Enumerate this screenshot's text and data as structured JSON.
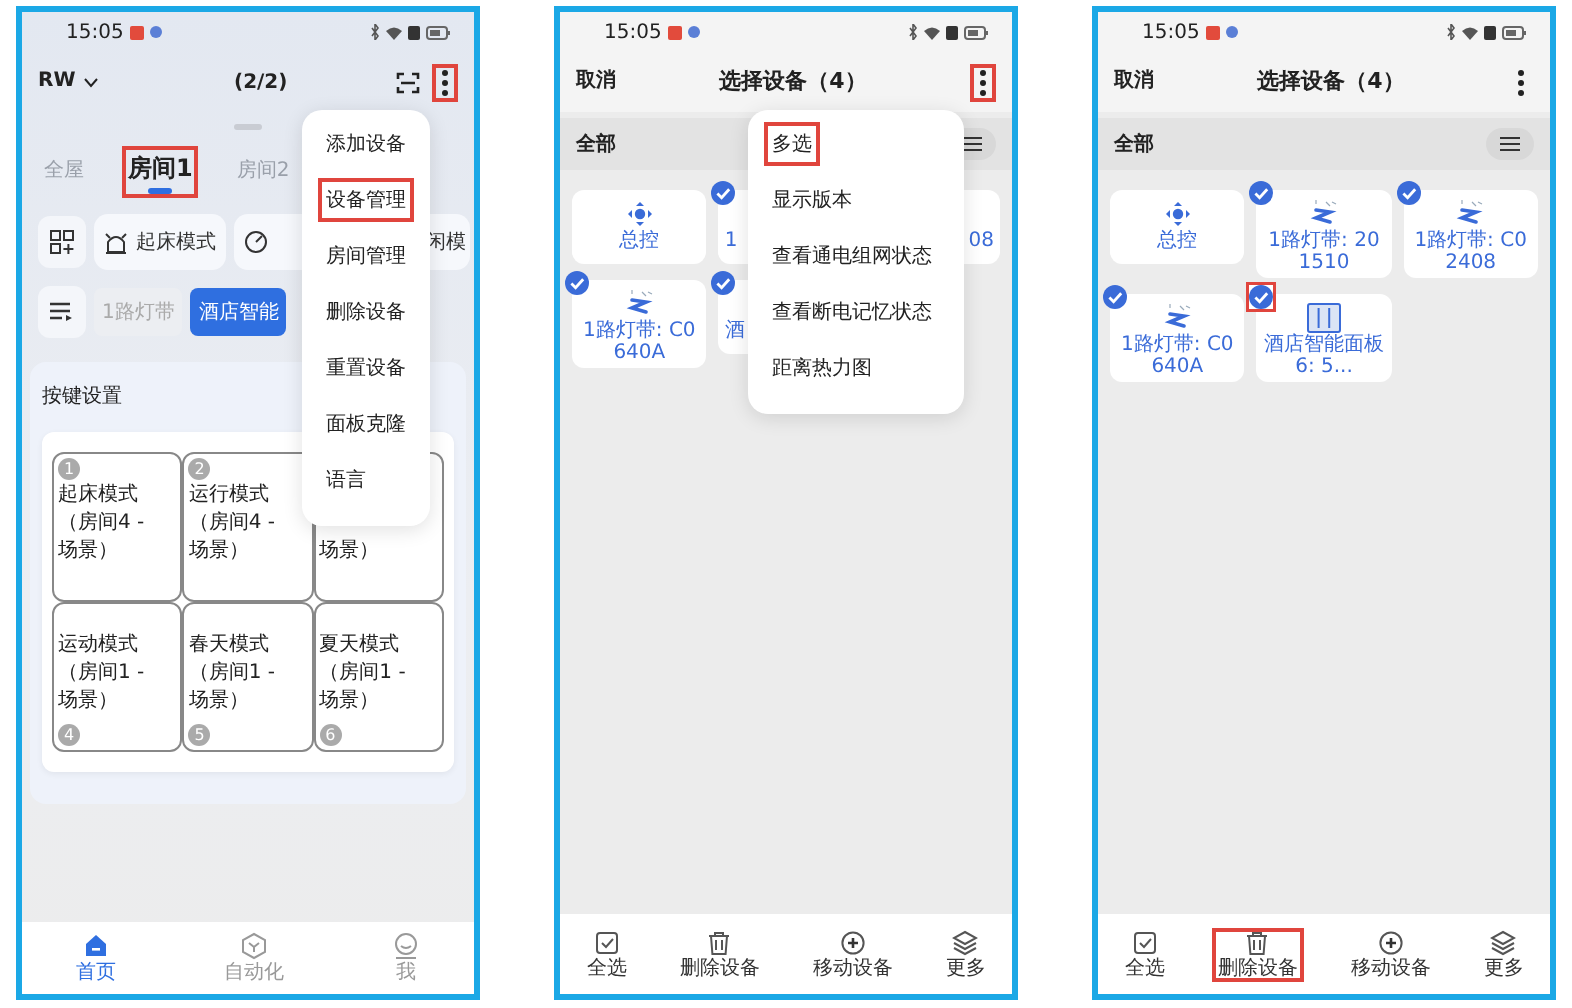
{
  "screens": [
    {
      "kind": "home",
      "status_time": "15:05",
      "home_name": "RW",
      "page_counter": "(2/2)",
      "more_highlighted": true,
      "room_tabs": [
        {
          "label": "全屋",
          "selected": false,
          "highlighted": false
        },
        {
          "label": "房间1",
          "selected": true,
          "highlighted": true
        },
        {
          "label": "房间2",
          "selected": false,
          "highlighted": false
        }
      ],
      "scenes": [
        {
          "label": "起床模式",
          "kind": "alarm"
        },
        {
          "label": "闲模",
          "kind": "dial"
        }
      ],
      "device_chips": [
        {
          "label": "1路灯带",
          "selected": false
        },
        {
          "label": "酒店智能",
          "selected": true
        }
      ],
      "key_card": {
        "title": "按键设置",
        "keys": [
          {
            "number": "1",
            "lines": [
              "起床模式",
              "（房间4 -",
              "场景）"
            ]
          },
          {
            "number": "2",
            "lines": [
              "运行模式",
              "（房间4 -",
              "场景）"
            ]
          },
          {
            "lines": [
              "场景）"
            ]
          },
          {
            "number": "4",
            "lines": [
              "运动模式",
              "（房间1 -",
              "场景）"
            ]
          },
          {
            "number": "5",
            "lines": [
              "春天模式",
              "（房间1 -",
              "场景）"
            ]
          },
          {
            "number": "6",
            "lines": [
              "夏天模式",
              "（房间1 -",
              "场景）"
            ]
          }
        ]
      },
      "menu": [
        {
          "label": "添加设备",
          "highlighted": false
        },
        {
          "label": "设备管理",
          "highlighted": true
        },
        {
          "label": "房间管理",
          "highlighted": false
        },
        {
          "label": "删除设备",
          "highlighted": false
        },
        {
          "label": "重置设备",
          "highlighted": false
        },
        {
          "label": "面板克隆",
          "highlighted": false
        },
        {
          "label": "语言",
          "highlighted": false
        }
      ],
      "nav": [
        {
          "label": "首页",
          "selected": true,
          "kind": "home"
        },
        {
          "label": "自动化",
          "selected": false,
          "kind": "cube"
        },
        {
          "label": "我",
          "selected": false,
          "kind": "profile"
        }
      ]
    },
    {
      "kind": "select",
      "status_time": "15:05",
      "cancel": "取消",
      "title": "选择设备（4）",
      "more_highlighted": true,
      "filter": "全部",
      "devices": [
        {
          "label": "总控",
          "kind": "hub",
          "checked": false
        },
        {
          "label": "1",
          "checked": true
        },
        {
          "label": "08",
          "checked": false
        },
        {
          "label": "1路灯带: C0640A",
          "kind": "strip",
          "checked": true
        },
        {
          "label": "酒",
          "checked": true
        }
      ],
      "menu": [
        {
          "label": "多选",
          "highlighted": true
        },
        {
          "label": "显示版本",
          "highlighted": false
        },
        {
          "label": "查看通电组网状态",
          "highlighted": false
        },
        {
          "label": "查看断电记忆状态",
          "highlighted": false
        },
        {
          "label": "距离热力图",
          "highlighted": false
        }
      ],
      "toolbar": [
        {
          "label": "全选",
          "kind": "select-all"
        },
        {
          "label": "删除设备",
          "kind": "trash"
        },
        {
          "label": "移动设备",
          "kind": "move"
        },
        {
          "label": "更多",
          "kind": "layers"
        }
      ]
    },
    {
      "kind": "select",
      "status_time": "15:05",
      "cancel": "取消",
      "title": "选择设备（4）",
      "more_highlighted": false,
      "filter": "全部",
      "devices": [
        {
          "label": "总控",
          "kind": "hub",
          "checked": false,
          "highlighted": false
        },
        {
          "label": "1路灯带: 201510",
          "kind": "strip",
          "checked": true,
          "highlighted": false
        },
        {
          "label": "1路灯带: C02408",
          "kind": "strip",
          "checked": true,
          "highlighted": false
        },
        {
          "label": "1路灯带: C0640A",
          "kind": "strip",
          "checked": true,
          "highlighted": false
        },
        {
          "label": "酒店智能面板6: 5...",
          "kind": "panel",
          "checked": true,
          "highlighted": true
        }
      ],
      "toolbar": [
        {
          "label": "全选",
          "kind": "select-all",
          "highlighted": false
        },
        {
          "label": "删除设备",
          "kind": "trash",
          "highlighted": true
        },
        {
          "label": "移动设备",
          "kind": "move",
          "highlighted": false
        },
        {
          "label": "更多",
          "kind": "layers",
          "highlighted": false
        }
      ]
    }
  ]
}
